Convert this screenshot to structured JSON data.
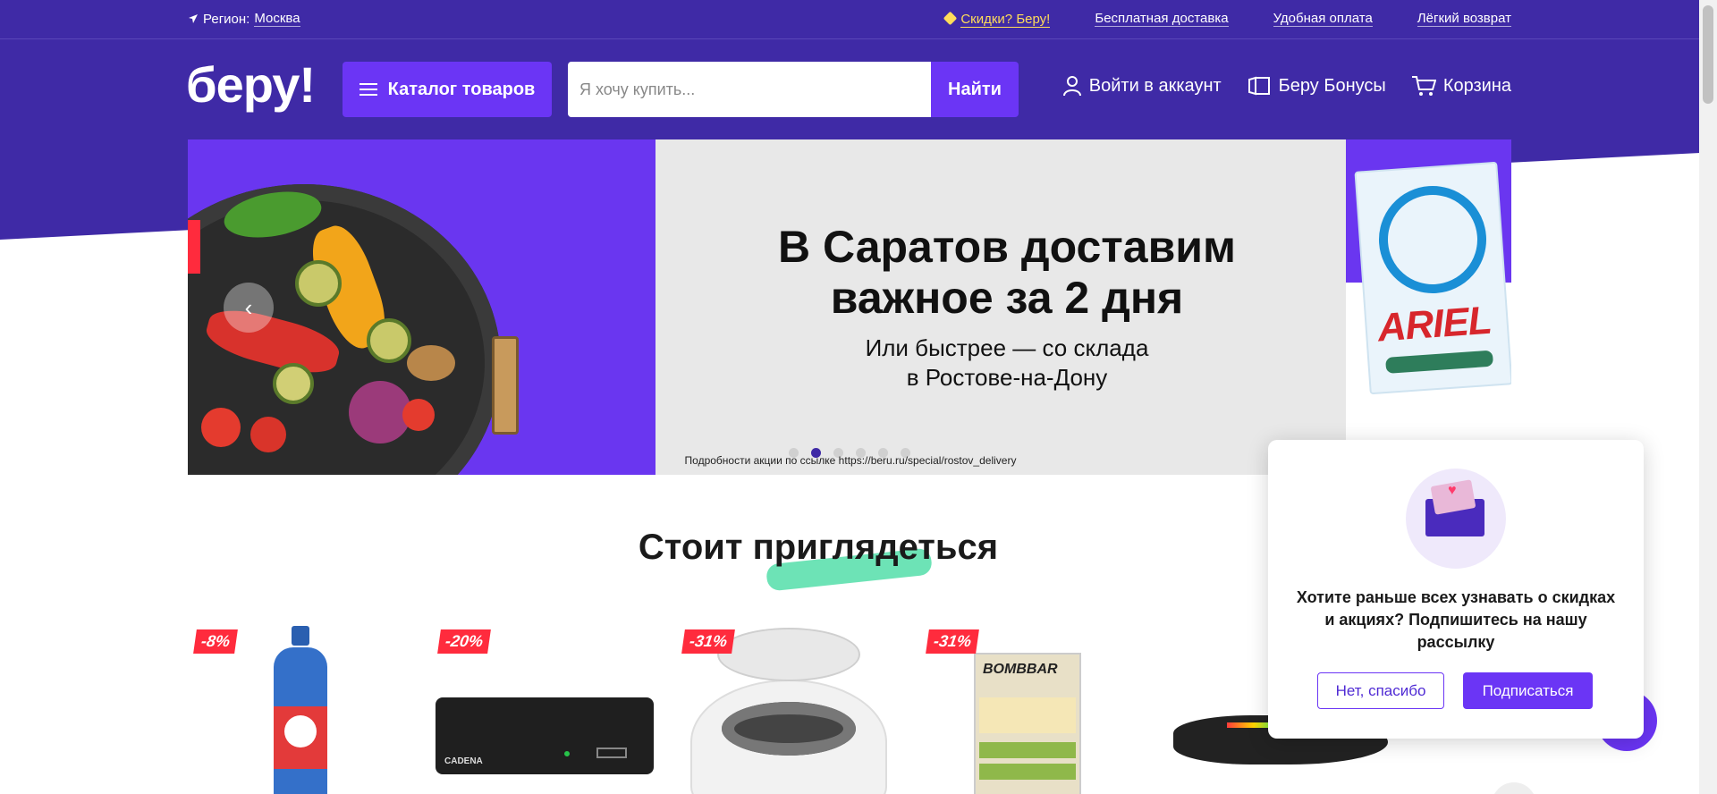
{
  "topbar": {
    "region_label": "Регион:",
    "region_city": "Москва",
    "links": [
      "Скидки? Беру!",
      "Бесплатная доставка",
      "Удобная оплата",
      "Лёгкий возврат"
    ]
  },
  "header": {
    "logo": "беру!",
    "catalog_label": "Каталог товаров",
    "search_placeholder": "Я хочу купить...",
    "search_button": "Найти",
    "login": "Войти в аккаунт",
    "bonuses": "Беру Бонусы",
    "cart": "Корзина"
  },
  "banner": {
    "headline_1": "В Саратов доставим",
    "headline_2": "важное за 2 дня",
    "sub_1": "Или быстрее — со склада",
    "sub_2": "в Ростове-на-Дону",
    "fine_print": "Подробности акции по ссылке https://beru.ru/special/rostov_delivery",
    "product_word": "ARIEL",
    "slides_total": 6,
    "active_slide": 2
  },
  "section": {
    "title": "Стоит приглядеться"
  },
  "products": [
    {
      "discount": "-8%"
    },
    {
      "discount": "-20%",
      "brand": "CADENA"
    },
    {
      "discount": "-31%"
    },
    {
      "discount": "-31%",
      "brand": "BOMBBAR"
    }
  ],
  "popup": {
    "text": "Хотите раньше всех узнавать о скидках и акциях? Подпишитесь на нашу рассылку",
    "no_button": "Нет, спасибо",
    "yes_button": "Подписаться"
  },
  "colors": {
    "brand_purple": "#3f2aa6",
    "accent_violet": "#6b35f5",
    "discount_red": "#ff2b3d",
    "promo_yellow": "#ffdc5a"
  }
}
